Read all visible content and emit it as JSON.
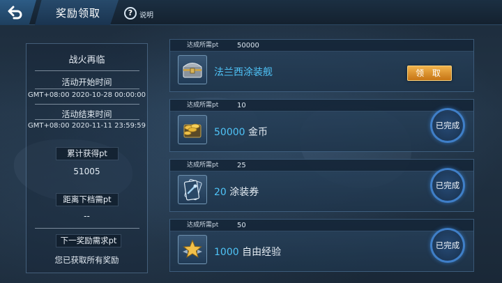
{
  "header": {
    "title": "奖励领取",
    "help_label": "说明",
    "help_symbol": "?"
  },
  "info_panel": {
    "event_name": "战火再临",
    "start_label": "活动开始时间",
    "start_value": "GMT+08:00 2020-10-28 00:00:00",
    "end_label": "活动结束时间",
    "end_value": "GMT+08:00 2020-11-11 23:59:59",
    "total_label": "累计获得pt",
    "total_value": "51005",
    "next_tier_label": "距离下档需pt",
    "next_tier_value": "--",
    "next_reward_label": "下一奖励需求pt",
    "next_reward_value": "您已获取所有奖励"
  },
  "rewards": [
    {
      "req_label": "达成所需pt",
      "req_value": "50000",
      "quantity": "",
      "name": "法兰西涂装舰",
      "icon": "chest-icon",
      "action": "领 取",
      "status": "claimable"
    },
    {
      "req_label": "达成所需pt",
      "req_value": "10",
      "quantity": "50000",
      "name": "金币",
      "icon": "gold-coins-icon",
      "action": "已完成",
      "status": "done"
    },
    {
      "req_label": "达成所需pt",
      "req_value": "25",
      "quantity": "20",
      "name": "涂装券",
      "icon": "paint-ticket-icon",
      "action": "已完成",
      "status": "done"
    },
    {
      "req_label": "达成所需pt",
      "req_value": "50",
      "quantity": "1000",
      "name": "自由经验",
      "icon": "star-icon",
      "action": "已完成",
      "status": "done"
    }
  ],
  "colors": {
    "accent_cyan": "#4fc3f7",
    "claim_button": "#e09a30",
    "done_ring": "#468cdc"
  }
}
